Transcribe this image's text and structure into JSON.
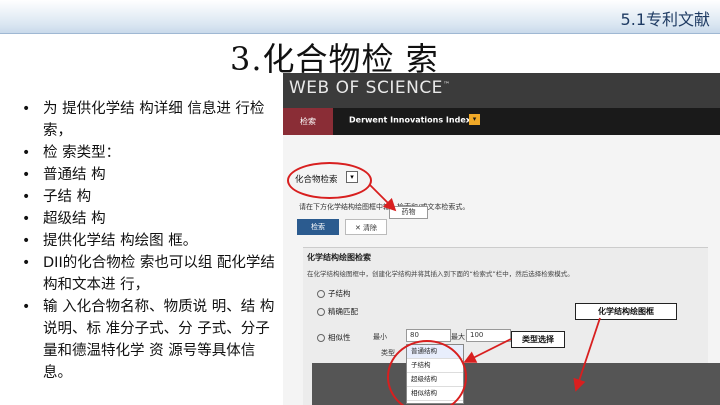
{
  "header": {
    "corner_label": "5.1专利文献"
  },
  "slide": {
    "title": "3.化合物检 索",
    "bullets": [
      "为 提供化学结 构详细 信息进 行检 索，",
      "检 索类型：",
      "普通结 构",
      "子结 构",
      "超级结 构",
      "提供化学结 构绘图 框。",
      "DII的化合物检 索也可以组 配化学结 构和文本进 行，",
      "输 入化合物名称、物质说 明、结 构说明、标 准分子式、分 子式、分子量和德温特化学 资 源号等具体信息。"
    ]
  },
  "screenshot": {
    "logo": "WEB OF SCIENCE",
    "logo_tm": "™",
    "search_tab": "检索",
    "database": "Derwent Innovations Index",
    "database_sup": "SM",
    "dropdown_arrow": "▾",
    "mode": "化合物检索",
    "description": "请在下方化学结构绘图框中输入检索和/或文本检索式。",
    "search_button": "检索",
    "clear_button": "✕ 清除",
    "panel_title": "化学结构绘图检索",
    "panel_description": "在化学结构绘图框中，创建化学结构并将其插入到下面的“检索式”栏中，然后选择检索模式。",
    "options": [
      "子结构",
      "精确匹配",
      "相似性"
    ],
    "formula_select": "药物",
    "min_label": "最小",
    "min_value": "80",
    "max_label": "最大",
    "max_value": "100",
    "type_label": "类型",
    "type_menu": [
      "普通结构",
      "子结构",
      "超级结构",
      "相似结构"
    ]
  },
  "annotations": {
    "draw_box": "化学结构绘图框",
    "type_select": "类型选择"
  },
  "colors": {
    "header_dark": "#3b3b3b",
    "nav_bar": "#1a1a1a",
    "search_tab": "#8a2d36",
    "accent_orange": "#f0a928",
    "search_button": "#2b5b8f",
    "highlight_red": "#d81f1f"
  }
}
